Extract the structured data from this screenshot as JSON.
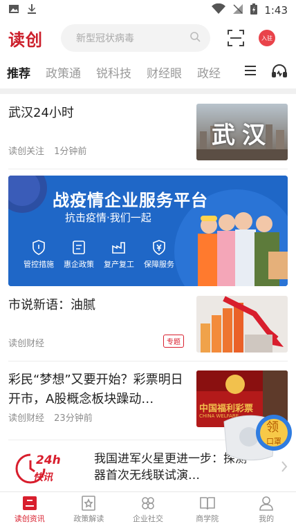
{
  "status": {
    "time": "1:43"
  },
  "header": {
    "logo_text": "读创",
    "search_placeholder": "新型冠状病毒",
    "avatar_text": "入驻"
  },
  "tabs": [
    "推荐",
    "政策通",
    "锐科技",
    "财经眼",
    "政经"
  ],
  "articles": [
    {
      "title": "武汉24小时",
      "source": "读创关注",
      "time": "1分钟前",
      "thumb_text": "武汉"
    },
    {
      "title": "市说新语：油腻",
      "source": "读创财经",
      "tag": "专题"
    },
    {
      "title": "彩民“梦想”又要开始？彩票明日开市，A股概念板块躁动…",
      "source": "读创财经",
      "time": "23分钟前",
      "thumb_text": "中国福利彩票",
      "thumb_sub": "CHINA WELFARE"
    }
  ],
  "banner": {
    "title": "战疫情企业服务平台",
    "subtitle": "抗击疫情·我们一起",
    "items": [
      "管控措施",
      "惠企政策",
      "复产复工",
      "保障服务"
    ]
  },
  "flash": {
    "badge_24": "24h",
    "badge_label": "快讯",
    "text": "我国进军火星更进一步：探测器首次无线联试演…"
  },
  "float": {
    "line1": "领",
    "line2": "口罩"
  },
  "bottom_nav": [
    {
      "label": "读创资讯",
      "icon": "news-icon",
      "active": true
    },
    {
      "label": "政策解读",
      "icon": "star-page-icon",
      "active": false
    },
    {
      "label": "企业社交",
      "icon": "clover-icon",
      "active": false
    },
    {
      "label": "商学院",
      "icon": "book-icon",
      "active": false
    },
    {
      "label": "我的",
      "icon": "user-icon",
      "active": false
    }
  ],
  "colors": {
    "accent": "#d81e2d",
    "banner": "#1f67c7"
  }
}
